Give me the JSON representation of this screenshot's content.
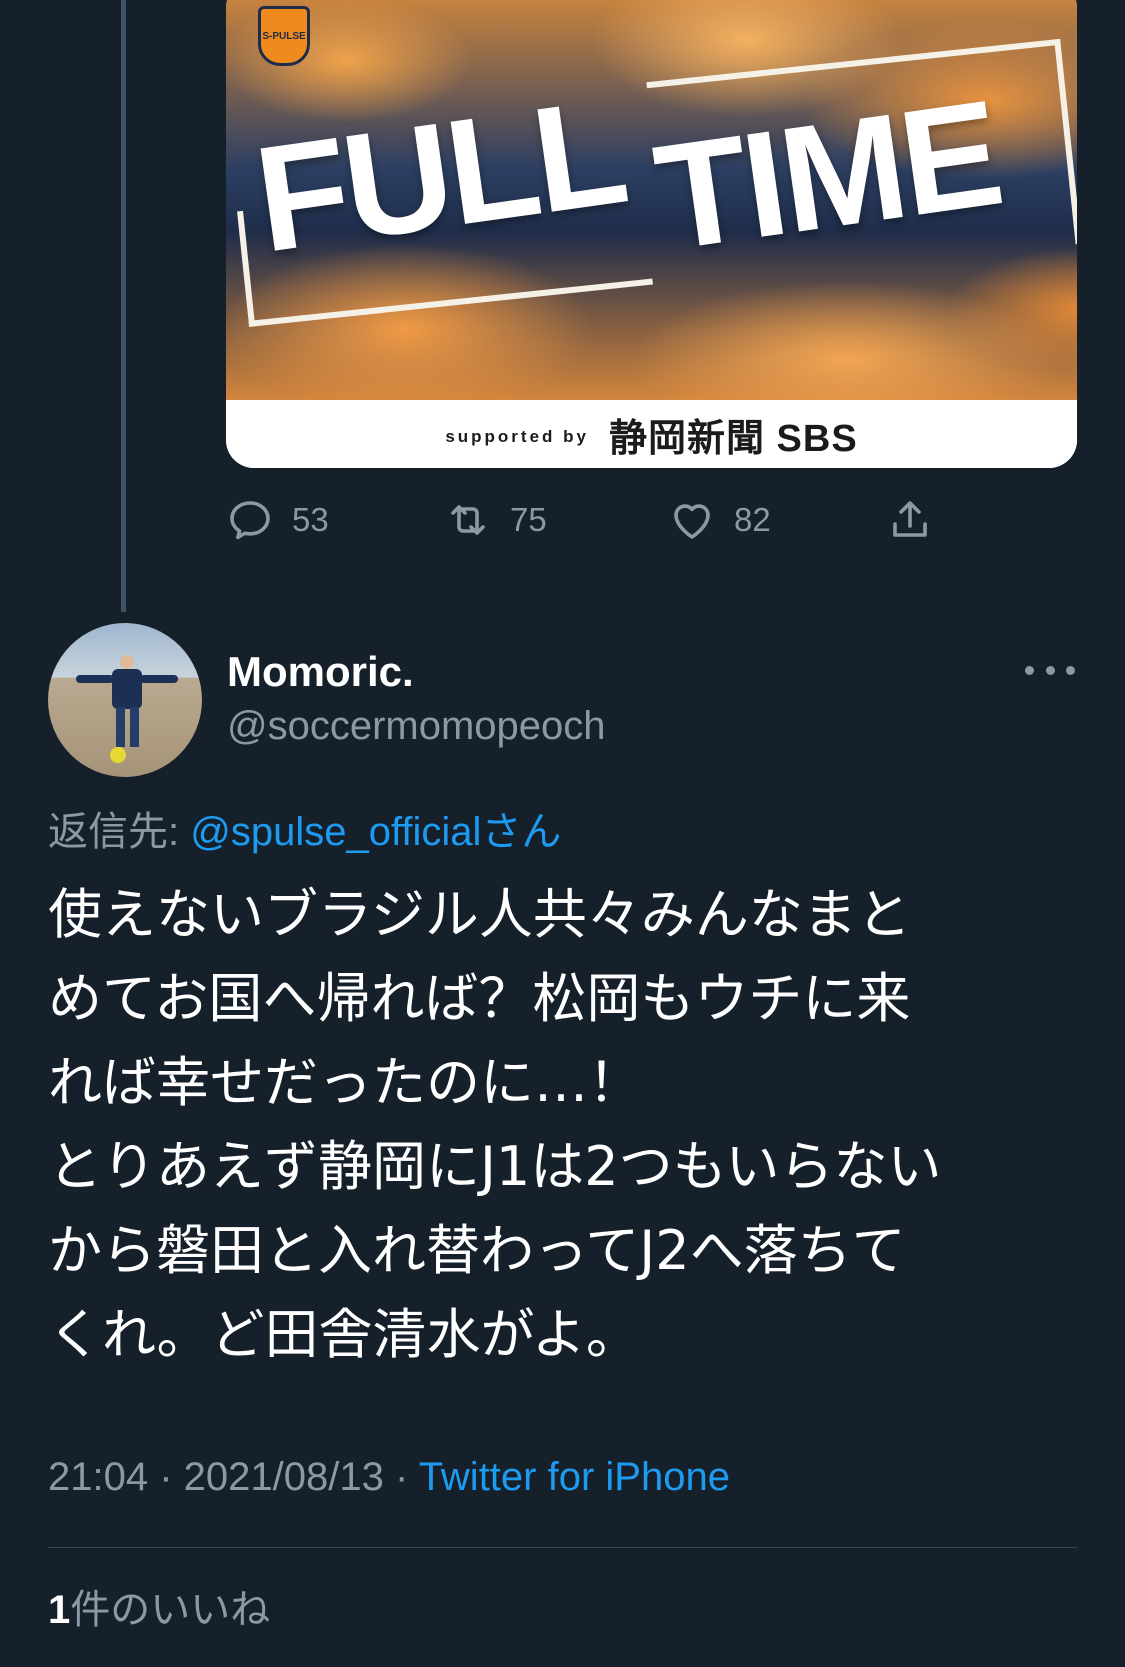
{
  "media": {
    "title_word_1": "FULL",
    "title_word_2": "TIME",
    "badge_text": "S-PULSE",
    "sponsor_prefix": "supported by",
    "sponsor_name": "静岡新聞 SBS"
  },
  "actions": {
    "reply_count": "53",
    "retweet_count": "75",
    "like_count": "82"
  },
  "author": {
    "display_name": "Momoric.",
    "handle": "@soccermomopeoch"
  },
  "reply_to": {
    "label": "返信先: ",
    "mention": "@spulse_officialさん"
  },
  "tweet": {
    "text": "使えないブラジル人共々みんなまと\nめてお国へ帰れば？松岡もウチに来\nれば幸せだったのに…！\nとりあえず静岡にJ1は2つもいらない\nから磐田と入れ替わってJ2へ落ちて\nくれ。ど田舎清水がよ。"
  },
  "meta": {
    "time": "21:04",
    "date": "2021/08/13",
    "separator": " · ",
    "source": "Twitter for iPhone"
  },
  "likes": {
    "count": "1",
    "label": "件のいいね"
  },
  "colors": {
    "background": "#15202b",
    "accent": "#1d9bf0",
    "secondary_text": "#8b98a5"
  }
}
